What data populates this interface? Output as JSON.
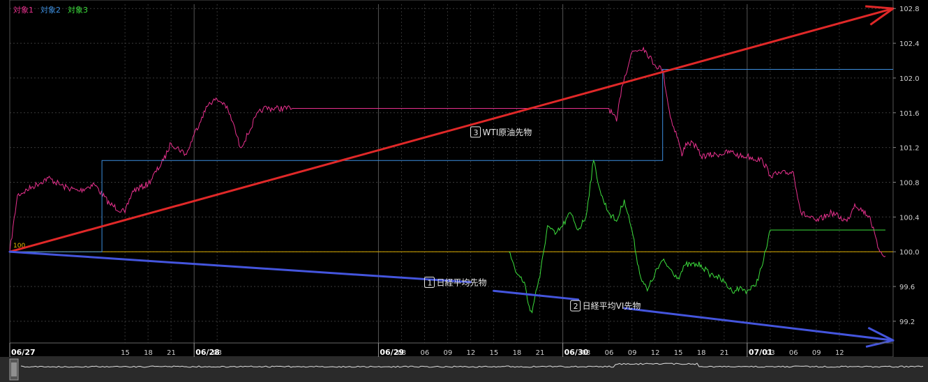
{
  "chart_data": {
    "type": "line",
    "title": "",
    "legend_placement": "top-left",
    "grid": true,
    "ylim": [
      98.95,
      102.85
    ],
    "y_ticks": [
      "102.8",
      "102.4",
      "102.0",
      "101.6",
      "101.2",
      "100.8",
      "100.4",
      "100.0",
      "99.6",
      "99.2"
    ],
    "baseline": {
      "value": 100,
      "label": "100",
      "color": "#e0b000"
    },
    "x_range": [
      "06/27 00:00",
      "07/01 19:00"
    ],
    "x_ticks": [
      {
        "at": "06/27 00:00",
        "label": "06/27",
        "major": true
      },
      {
        "at": "06/27 15:00",
        "label": "15",
        "major": false
      },
      {
        "at": "06/27 18:00",
        "label": "18",
        "major": false
      },
      {
        "at": "06/27 21:00",
        "label": "21",
        "major": false
      },
      {
        "at": "06/28 00:00",
        "label": "06/28",
        "major": true
      },
      {
        "at": "06/28 03:00",
        "label": "03",
        "major": false
      },
      {
        "at": "06/29 00:00",
        "label": "06/29",
        "major": true
      },
      {
        "at": "06/29 03:00",
        "label": "03",
        "major": false
      },
      {
        "at": "06/29 06:00",
        "label": "06",
        "major": false
      },
      {
        "at": "06/29 09:00",
        "label": "09",
        "major": false
      },
      {
        "at": "06/29 12:00",
        "label": "12",
        "major": false
      },
      {
        "at": "06/29 15:00",
        "label": "15",
        "major": false
      },
      {
        "at": "06/29 18:00",
        "label": "18",
        "major": false
      },
      {
        "at": "06/29 21:00",
        "label": "21",
        "major": false
      },
      {
        "at": "06/30 00:00",
        "label": "06/30",
        "major": true
      },
      {
        "at": "06/30 03:00",
        "label": "03",
        "major": false
      },
      {
        "at": "06/30 06:00",
        "label": "06",
        "major": false
      },
      {
        "at": "06/30 09:00",
        "label": "09",
        "major": false
      },
      {
        "at": "06/30 12:00",
        "label": "12",
        "major": false
      },
      {
        "at": "06/30 15:00",
        "label": "15",
        "major": false
      },
      {
        "at": "06/30 18:00",
        "label": "18",
        "major": false
      },
      {
        "at": "06/30 21:00",
        "label": "21",
        "major": false
      },
      {
        "at": "07/01 00:00",
        "label": "07/01",
        "major": true
      },
      {
        "at": "07/01 03:00",
        "label": "03",
        "major": false
      },
      {
        "at": "07/01 06:00",
        "label": "06",
        "major": false
      },
      {
        "at": "07/01 09:00",
        "label": "09",
        "major": false
      },
      {
        "at": "07/01 12:00",
        "label": "12",
        "major": false
      }
    ],
    "series": [
      {
        "name": "対象1",
        "color": "#e8318e",
        "points": [
          [
            "06/27 00:00",
            100.0
          ],
          [
            "06/27 01:00",
            100.65
          ],
          [
            "06/27 03:00",
            100.75
          ],
          [
            "06/27 05:00",
            100.85
          ],
          [
            "06/27 07:00",
            100.75
          ],
          [
            "06/27 09:00",
            100.7
          ],
          [
            "06/27 11:00",
            100.78
          ],
          [
            "06/27 13:00",
            100.55
          ],
          [
            "06/27 15:00",
            100.45
          ],
          [
            "06/27 16:00",
            100.7
          ],
          [
            "06/27 18:00",
            100.78
          ],
          [
            "06/27 20:00",
            101.05
          ],
          [
            "06/27 21:00",
            101.25
          ],
          [
            "06/27 23:00",
            101.12
          ],
          [
            "06/28 00:00",
            101.35
          ],
          [
            "06/28 01:00",
            101.55
          ],
          [
            "06/28 02:00",
            101.72
          ],
          [
            "06/28 03:00",
            101.75
          ],
          [
            "06/28 04:00",
            101.7
          ],
          [
            "06/28 05:00",
            101.5
          ],
          [
            "06/28 06:00",
            101.2
          ],
          [
            "06/28 07:00",
            101.35
          ],
          [
            "06/28 08:00",
            101.55
          ],
          [
            "06/28 09:00",
            101.65
          ],
          [
            "06/28 13:00",
            101.65
          ],
          [
            "06/29 00:00",
            101.65
          ],
          [
            "06/30 06:00",
            101.65
          ],
          [
            "06/30 07:00",
            101.5
          ],
          [
            "06/30 07:40",
            101.9
          ],
          [
            "06/30 09:00",
            102.3
          ],
          [
            "06/30 10:30",
            102.35
          ],
          [
            "06/30 12:00",
            102.15
          ],
          [
            "06/30 13:00",
            102.1
          ],
          [
            "06/30 14:00",
            101.55
          ],
          [
            "06/30 15:00",
            101.3
          ],
          [
            "06/30 15:30",
            101.1
          ],
          [
            "06/30 16:00",
            101.25
          ],
          [
            "06/30 17:00",
            101.25
          ],
          [
            "06/30 18:00",
            101.1
          ],
          [
            "06/30 20:00",
            101.12
          ],
          [
            "06/30 22:00",
            101.15
          ],
          [
            "06/30 23:00",
            101.1
          ],
          [
            "07/01 00:00",
            101.1
          ],
          [
            "07/01 02:00",
            101.05
          ],
          [
            "07/01 03:00",
            100.88
          ],
          [
            "07/01 06:00",
            100.92
          ],
          [
            "07/01 07:00",
            100.45
          ],
          [
            "07/01 09:00",
            100.35
          ],
          [
            "07/01 11:00",
            100.45
          ],
          [
            "07/01 13:00",
            100.35
          ],
          [
            "07/01 14:00",
            100.55
          ],
          [
            "07/01 16:00",
            100.4
          ],
          [
            "07/01 17:00",
            100.05
          ],
          [
            "07/01 18:00",
            99.95
          ]
        ]
      },
      {
        "name": "対象2",
        "color": "#3d8fe0",
        "points": [
          [
            "06/27 00:00",
            100.0
          ],
          [
            "06/27 12:00",
            100.0
          ],
          [
            "06/27 12:00",
            101.05
          ],
          [
            "06/30 13:00",
            101.05
          ],
          [
            "06/30 13:00",
            102.1
          ],
          [
            "07/01 19:00",
            102.1
          ]
        ]
      },
      {
        "name": "対象3",
        "color": "#3cde3c",
        "points": [
          [
            "06/29 17:00",
            100.0
          ],
          [
            "06/29 18:00",
            99.75
          ],
          [
            "06/29 19:00",
            99.65
          ],
          [
            "06/29 19:30",
            99.4
          ],
          [
            "06/29 20:00",
            99.3
          ],
          [
            "06/29 20:30",
            99.55
          ],
          [
            "06/29 21:00",
            99.7
          ],
          [
            "06/29 22:00",
            100.3
          ],
          [
            "06/29 23:00",
            100.2
          ],
          [
            "06/30 00:00",
            100.3
          ],
          [
            "06/30 01:00",
            100.45
          ],
          [
            "06/30 02:00",
            100.25
          ],
          [
            "06/30 03:00",
            100.4
          ],
          [
            "06/30 04:00",
            101.05
          ],
          [
            "06/30 05:00",
            100.65
          ],
          [
            "06/30 06:00",
            100.45
          ],
          [
            "06/30 07:00",
            100.35
          ],
          [
            "06/30 08:00",
            100.6
          ],
          [
            "06/30 09:00",
            100.25
          ],
          [
            "06/30 10:00",
            99.75
          ],
          [
            "06/30 11:00",
            99.55
          ],
          [
            "06/30 12:00",
            99.75
          ],
          [
            "06/30 13:00",
            99.9
          ],
          [
            "06/30 14:00",
            99.8
          ],
          [
            "06/30 15:00",
            99.7
          ],
          [
            "06/30 16:00",
            99.85
          ],
          [
            "06/30 18:00",
            99.85
          ],
          [
            "06/30 19:00",
            99.75
          ],
          [
            "06/30 20:00",
            99.72
          ],
          [
            "06/30 21:00",
            99.65
          ],
          [
            "06/30 22:00",
            99.55
          ],
          [
            "06/30 23:00",
            99.58
          ],
          [
            "07/01 00:00",
            99.55
          ],
          [
            "07/01 01:00",
            99.6
          ],
          [
            "07/01 02:00",
            99.85
          ],
          [
            "07/01 03:00",
            100.25
          ],
          [
            "07/01 18:00",
            100.25
          ]
        ]
      }
    ],
    "trend_lines": [
      {
        "color": "#e02828",
        "from": [
          "06/27 00:00",
          100.0
        ],
        "to": [
          "07/01 19:00",
          102.8
        ],
        "arrow": true
      },
      {
        "color": "#4455dd",
        "from": [
          "06/27 00:00",
          100.0
        ],
        "to": [
          "06/29 12:00",
          99.65
        ],
        "arrow": false
      },
      {
        "color": "#4455dd",
        "from": [
          "06/29 15:00",
          99.55
        ],
        "to": [
          "06/30 02:00",
          99.45
        ],
        "arrow": false
      },
      {
        "color": "#4455dd",
        "from": [
          "06/30 08:00",
          99.35
        ],
        "to": [
          "07/01 19:00",
          98.98
        ],
        "arrow": true
      }
    ],
    "annotations": [
      {
        "num": "3",
        "text": "WTI原油先物",
        "at": [
          "06/29 12:00",
          101.35
        ]
      },
      {
        "num": "1",
        "text": "日経平均先物",
        "at": [
          "06/29 06:00",
          99.62
        ]
      },
      {
        "num": "2",
        "text": "日経平均VI先物",
        "at": [
          "06/30 01:00",
          99.35
        ]
      }
    ]
  }
}
